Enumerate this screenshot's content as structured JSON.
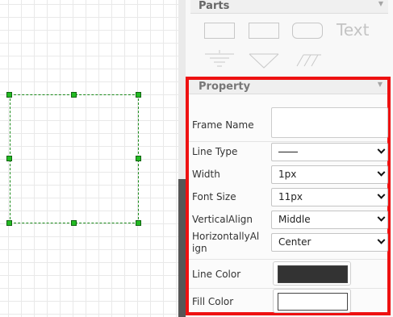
{
  "parts": {
    "title": "Parts",
    "text_tool_label": "Text"
  },
  "property": {
    "title": "Property",
    "frame_name": {
      "label": "Frame Name",
      "value": ""
    },
    "line_type": {
      "label": "Line Type",
      "value": ""
    },
    "width": {
      "label": "Width",
      "value": "1px"
    },
    "font_size": {
      "label": "Font Size",
      "value": "11px"
    },
    "vertical_align": {
      "label": "VerticalAlign",
      "value": "Middle"
    },
    "horizontal_align": {
      "label": "HorizontallyAl\nign",
      "value": "Center"
    },
    "line_color": {
      "label": "Line Color",
      "value": "#333333"
    },
    "fill_color": {
      "label": "Fill Color",
      "value": "#ffffff"
    }
  },
  "colors": {
    "highlight": "#ee1111",
    "selection": "#22bb22"
  },
  "icons": [
    "chevron-down-icon",
    "rectangle-shape-icon",
    "rounded-rectangle-shape-icon",
    "ground-symbol-icon",
    "triangle-shape-icon",
    "hatch-lines-icon"
  ]
}
